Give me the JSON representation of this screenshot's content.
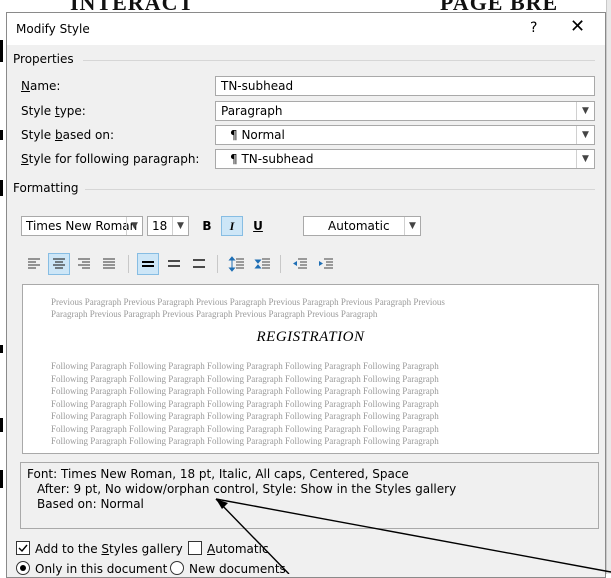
{
  "background": {
    "top_text_left": "INTERACT",
    "top_text_right": "PAGE BRE"
  },
  "window": {
    "title": "Modify Style",
    "help": "?",
    "close": "✕"
  },
  "properties": {
    "heading": "Properties",
    "name_label_u": "N",
    "name_label_rest": "ame:",
    "name_value": "TN-subhead",
    "type_label_pre": "Style ",
    "type_label_u": "t",
    "type_label_rest": "ype:",
    "type_value": "Paragraph",
    "based_label_pre": "Style ",
    "based_label_u": "b",
    "based_label_rest": "ased on:",
    "based_value": "¶  Normal",
    "following_label_u": "S",
    "following_label_rest": "tyle for following paragraph:",
    "following_value": "¶  TN-subhead"
  },
  "formatting": {
    "heading": "Formatting",
    "font": "Times New Roman",
    "size": "18",
    "bold": "B",
    "italic": "I",
    "underline": "U",
    "color": "Automatic"
  },
  "preview": {
    "previous_line1": "Previous Paragraph Previous Paragraph Previous Paragraph Previous Paragraph Previous Paragraph Previous",
    "previous_line2": "Paragraph Previous Paragraph Previous Paragraph Previous Paragraph Previous Paragraph",
    "sample": "REGISTRATION",
    "following_lines": [
      "Following Paragraph Following Paragraph Following Paragraph Following Paragraph Following Paragraph",
      "Following Paragraph Following Paragraph Following Paragraph Following Paragraph Following Paragraph",
      "Following Paragraph Following Paragraph Following Paragraph Following Paragraph Following Paragraph",
      "Following Paragraph Following Paragraph Following Paragraph Following Paragraph Following Paragraph",
      "Following Paragraph Following Paragraph Following Paragraph Following Paragraph Following Paragraph",
      "Following Paragraph Following Paragraph Following Paragraph Following Paragraph Following Paragraph",
      "Following Paragraph Following Paragraph Following Paragraph Following Paragraph Following Paragraph"
    ]
  },
  "description": {
    "line1": "Font: Times New Roman, 18 pt, Italic, All caps, Centered, Space",
    "line2": "After:  9 pt, No widow/orphan control, Style: Show in the Styles gallery",
    "line3": "Based on: Normal"
  },
  "options": {
    "add_gallery_pre": "Add to the ",
    "add_gallery_u": "S",
    "add_gallery_rest": "tyles gallery",
    "add_gallery_checked": true,
    "auto_u": "A",
    "auto_rest": "utomatic",
    "auto_checked": false,
    "only_doc": "Only in this document",
    "new_docs": "New documents"
  },
  "colors": {
    "active_button": "#cde6f7",
    "dialog_bg": "#f0f0f0"
  }
}
